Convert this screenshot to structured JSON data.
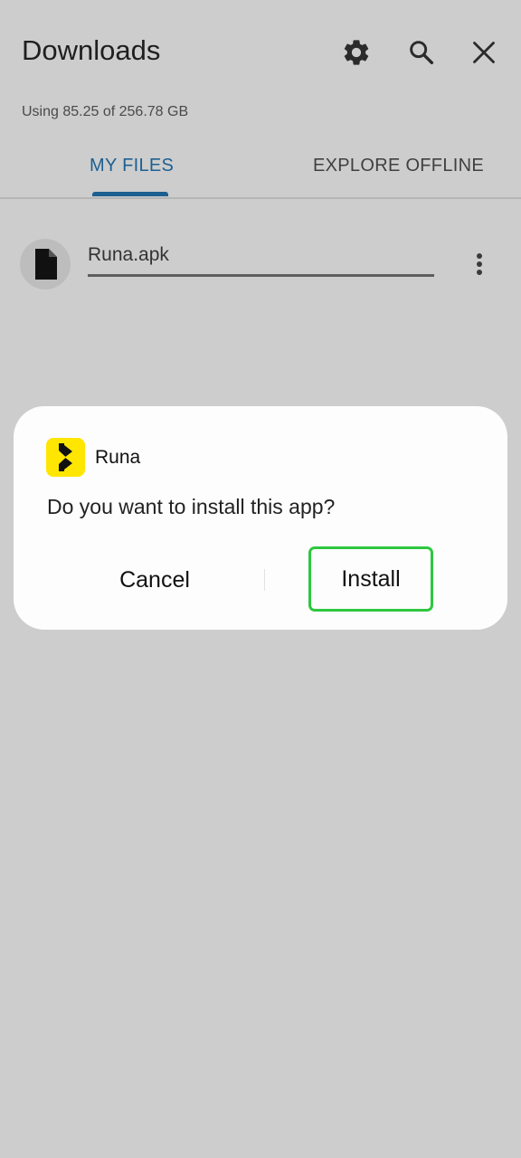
{
  "header": {
    "title": "Downloads",
    "storage_text": "Using 85.25 of 256.78 GB"
  },
  "tabs": [
    {
      "label": "MY FILES",
      "active": true
    },
    {
      "label": "EXPLORE OFFLINE",
      "active": false
    }
  ],
  "files": [
    {
      "name": "Runa.apk",
      "icon": "document-icon",
      "progress": 1.0
    }
  ],
  "dialog": {
    "app_name": "Runa",
    "app_icon": "runa-app-icon",
    "question": "Do you want to install this app?",
    "cancel_label": "Cancel",
    "install_label": "Install"
  },
  "colors": {
    "accent": "#1d5f91",
    "highlight": "#2ec840",
    "app_icon_bg": "#ffe600",
    "background": "#cdcdcd"
  },
  "icons": [
    "gear-icon",
    "search-icon",
    "close-icon",
    "document-icon",
    "more-vert-icon"
  ]
}
